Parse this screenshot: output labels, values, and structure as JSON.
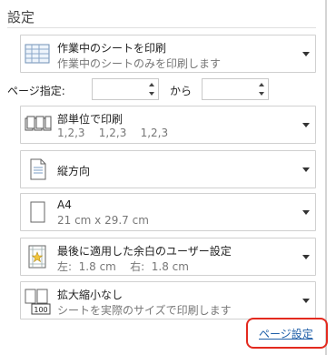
{
  "section": {
    "title": "設定"
  },
  "print_what": {
    "title": "作業中のシートを印刷",
    "subtitle": "作業中のシートのみを印刷します",
    "icon": "sheet-icon"
  },
  "pages": {
    "label": "ページ指定:",
    "from_value": "",
    "to_label": "から",
    "to_value": ""
  },
  "collation": {
    "title": "部単位で印刷",
    "subtitle": "1,2,3    1,2,3    1,2,3",
    "icon": "collate-icon"
  },
  "orientation": {
    "title": "縦方向",
    "icon": "portrait-icon"
  },
  "paper_size": {
    "title": "A4",
    "subtitle": "21 cm x 29.7 cm",
    "icon": "paper-icon"
  },
  "margins": {
    "title": "最後に適用した余白のユーザー設定",
    "subtitle": "左:  1.8 cm    右:  1.8 cm",
    "icon": "margins-icon"
  },
  "scaling": {
    "title": "拡大縮小なし",
    "subtitle": "シートを実際のサイズで印刷します",
    "icon": "scaling-icon",
    "icon_text": "100"
  },
  "footer": {
    "page_setup_link": "ページ設定",
    "highlight_color": "#e32a1f"
  }
}
